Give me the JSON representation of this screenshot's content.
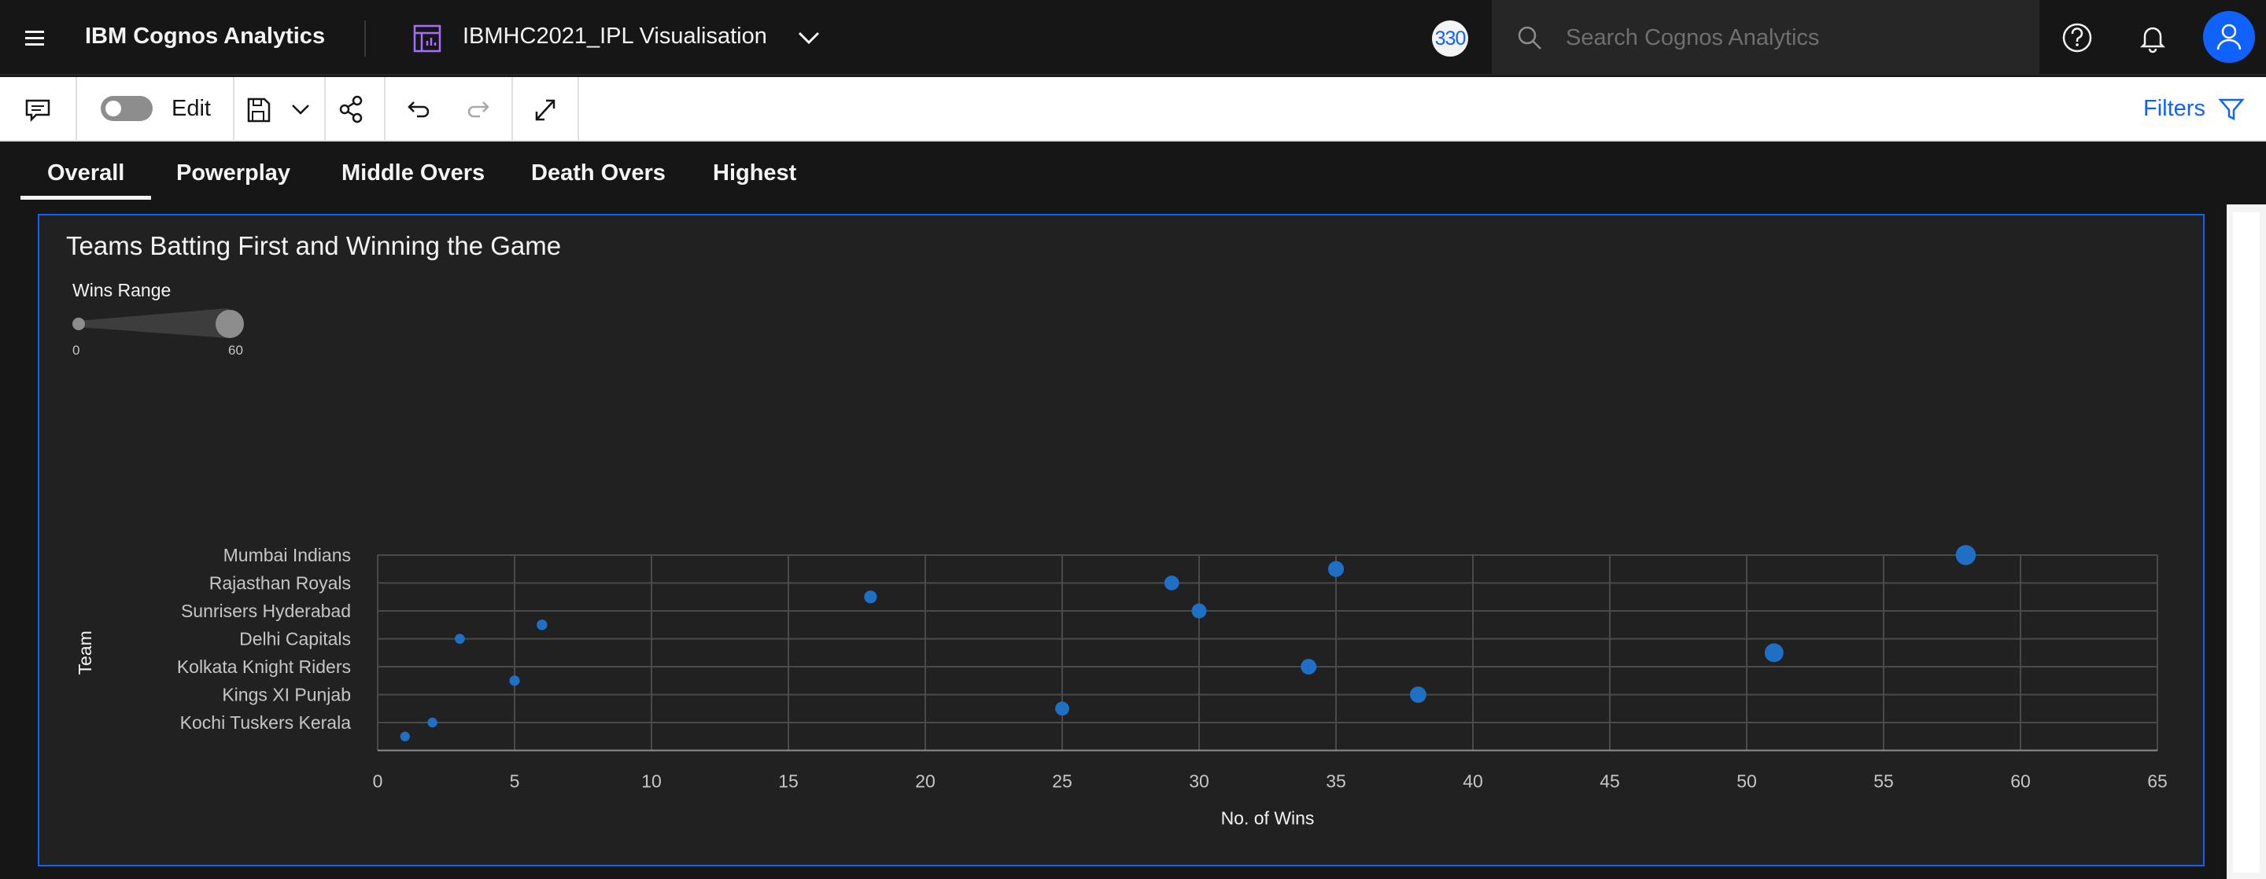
{
  "header": {
    "brand": "IBM Cognos Analytics",
    "report_title": "IBMHC2021_IPL Visualisation",
    "badge": "330",
    "search_placeholder": "Search Cognos Analytics"
  },
  "toolbar": {
    "edit_label": "Edit",
    "filters_label": "Filters"
  },
  "tabs": [
    {
      "label": "Overall",
      "active": true
    },
    {
      "label": "Powerplay",
      "active": false
    },
    {
      "label": "Middle Overs",
      "active": false
    },
    {
      "label": "Death Overs",
      "active": false
    },
    {
      "label": "Highest",
      "active": false
    }
  ],
  "widget": {
    "title": "Teams Batting First and Winning the Game",
    "legend": {
      "title": "Wins Range",
      "min": "0",
      "max": "60"
    }
  },
  "colors": {
    "accent": "#0f62fe",
    "point": "#1f6fc4"
  },
  "chart_data": {
    "type": "scatter",
    "title": "Teams Batting First and Winning the Game",
    "xlabel": "No. of Wins",
    "ylabel": "Team",
    "xlim": [
      0,
      65
    ],
    "xticks": [
      "0",
      "5",
      "10",
      "15",
      "20",
      "25",
      "30",
      "35",
      "40",
      "45",
      "50",
      "55",
      "60",
      "65"
    ],
    "categories": [
      "Mumbai Indians",
      "Rajasthan Royals",
      "Sunrisers Hyderabad",
      "Delhi Capitals",
      "Kolkata Knight Riders",
      "Kings XI Punjab",
      "Kochi Tuskers Kerala"
    ],
    "grid": true,
    "size_legend": {
      "title": "Wins Range",
      "min": 0,
      "max": 60
    },
    "points": [
      {
        "x": 58,
        "y": 0.0
      },
      {
        "x": 35,
        "y": 0.5
      },
      {
        "x": 29,
        "y": 1.0
      },
      {
        "x": 18,
        "y": 1.5
      },
      {
        "x": 30,
        "y": 2.0
      },
      {
        "x": 6,
        "y": 2.5
      },
      {
        "x": 3,
        "y": 3.0
      },
      {
        "x": 51,
        "y": 3.5
      },
      {
        "x": 34,
        "y": 4.0
      },
      {
        "x": 5,
        "y": 4.5
      },
      {
        "x": 38,
        "y": 5.0
      },
      {
        "x": 25,
        "y": 5.5
      },
      {
        "x": 2,
        "y": 6.0
      },
      {
        "x": 1,
        "y": 6.5
      }
    ]
  }
}
